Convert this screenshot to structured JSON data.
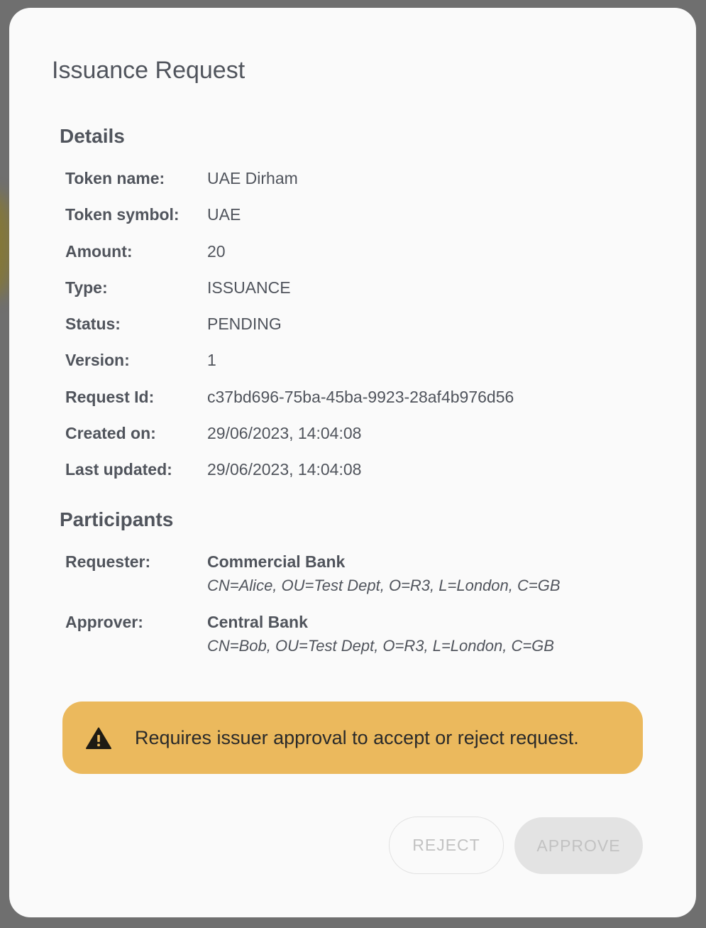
{
  "dialog": {
    "title": "Issuance Request"
  },
  "details": {
    "heading": "Details",
    "rows": [
      {
        "label": "Token name:",
        "value": "UAE Dirham"
      },
      {
        "label": "Token symbol:",
        "value": "UAE"
      },
      {
        "label": "Amount:",
        "value": "20"
      },
      {
        "label": "Type:",
        "value": "ISSUANCE"
      },
      {
        "label": "Status:",
        "value": "PENDING"
      },
      {
        "label": "Version:",
        "value": "1"
      },
      {
        "label": "Request Id:",
        "value": "c37bd696-75ba-45ba-9923-28af4b976d56"
      },
      {
        "label": "Created on:",
        "value": "29/06/2023, 14:04:08"
      },
      {
        "label": "Last updated:",
        "value": "29/06/2023, 14:04:08"
      }
    ]
  },
  "participants": {
    "heading": "Participants",
    "requester": {
      "label": "Requester:",
      "name": "Commercial Bank",
      "dn": "CN=Alice, OU=Test Dept, O=R3, L=London, C=GB"
    },
    "approver": {
      "label": "Approver:",
      "name": "Central Bank",
      "dn": "CN=Bob, OU=Test Dept, O=R3, L=London, C=GB"
    }
  },
  "alert": {
    "icon": "warning-icon",
    "message": "Requires issuer approval to accept or reject request.",
    "color": "#ebb95d"
  },
  "actions": {
    "reject_label": "REJECT",
    "approve_label": "APPROVE"
  }
}
